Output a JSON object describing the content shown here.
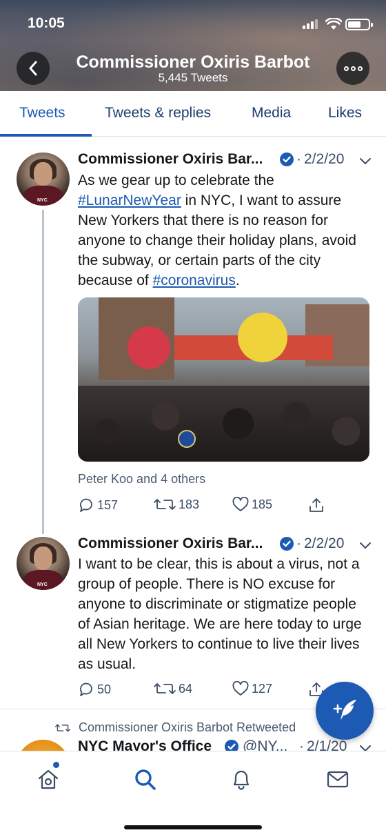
{
  "status_bar": {
    "time": "10:05"
  },
  "header": {
    "profile_name": "Commissioner Oxiris Barbot",
    "tweet_count": "5,445 Tweets"
  },
  "tabs": [
    {
      "label": "Tweets",
      "active": true
    },
    {
      "label": "Tweets & replies",
      "active": false
    },
    {
      "label": "Media",
      "active": false
    },
    {
      "label": "Likes",
      "active": false
    }
  ],
  "tweets": [
    {
      "author": "Commissioner Oxiris Bar...",
      "date": "2/2/20",
      "text_parts": {
        "t1": "As we gear up to celebrate the ",
        "link1": "#LunarNewYear",
        "t2": " in NYC, I want to assure New Yorkers that there is no reason for anyone to change their holiday plans, avoid the subway, or certain parts of the city because of ",
        "link2": "#coronavirus",
        "t3": "."
      },
      "tagged": "Peter Koo and 4 others",
      "replies": "157",
      "retweets": "183",
      "likes": "185"
    },
    {
      "author": "Commissioner Oxiris Bar...",
      "date": "2/2/20",
      "text": "I want to be clear, this is about a virus, not a group of people. There is NO excuse for anyone to discriminate or stigmatize people of Asian heritage. We are here today to urge all New Yorkers to continue to live their lives as usual.",
      "replies": "50",
      "retweets": "64",
      "likes": "127"
    },
    {
      "retweeted_by": "Commissioner Oxiris Barbot Retweeted",
      "author": "NYC Mayor's Office",
      "handle": "@NY...",
      "date": "2/1/20"
    }
  ],
  "date_separator": "·",
  "icons": {
    "back": "chevron-left-icon",
    "more": "more-icon",
    "verified": "verified-badge-icon",
    "caret": "chevron-down-icon",
    "reply": "reply-icon",
    "retweet": "retweet-icon",
    "like": "heart-icon",
    "share": "share-icon",
    "compose": "compose-tweet-icon",
    "home": "home-icon",
    "search": "search-icon",
    "notifications": "bell-icon",
    "messages": "mail-icon"
  },
  "colors": {
    "accent": "#1c5ab3",
    "text": "#14171a",
    "muted": "#3c4d63"
  }
}
